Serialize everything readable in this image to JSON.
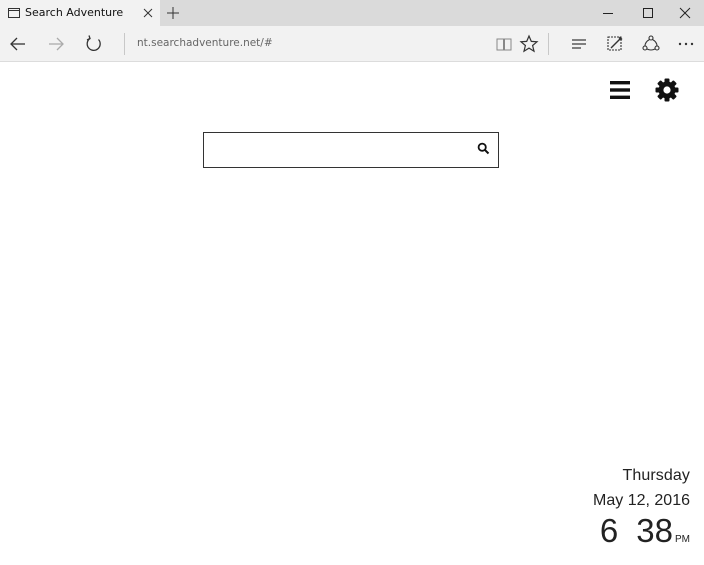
{
  "tab": {
    "title": "Search Adventure",
    "page_icon": "page-icon",
    "close_icon": "close-icon"
  },
  "new_tab_icon": "plus-icon",
  "window_controls": {
    "minimize_icon": "minimize-icon",
    "maximize_icon": "maximize-icon",
    "close_icon": "close-icon"
  },
  "navbar": {
    "back_icon": "arrow-left-icon",
    "forward_icon": "arrow-right-icon",
    "refresh_icon": "refresh-icon",
    "address": "nt.searchadventure.net/#",
    "reading_view_icon": "book-icon",
    "favorite_icon": "star-icon",
    "hub_icon": "hub-icon",
    "note_icon": "web-note-icon",
    "share_icon": "share-icon",
    "more_icon": "more-icon"
  },
  "page": {
    "menu_icon": "hamburger-menu-icon",
    "settings_icon": "gear-icon",
    "search": {
      "value": "",
      "placeholder": "",
      "button_icon": "search-icon"
    },
    "clock": {
      "day": "Thursday",
      "date": "May 12, 2016",
      "hour": "6",
      "minute": "38",
      "ampm": "PM"
    }
  },
  "colors": {
    "tabbar": "#dadada",
    "toolbar": "#f2f2f2",
    "text": "#222222",
    "address_text": "#666666"
  }
}
